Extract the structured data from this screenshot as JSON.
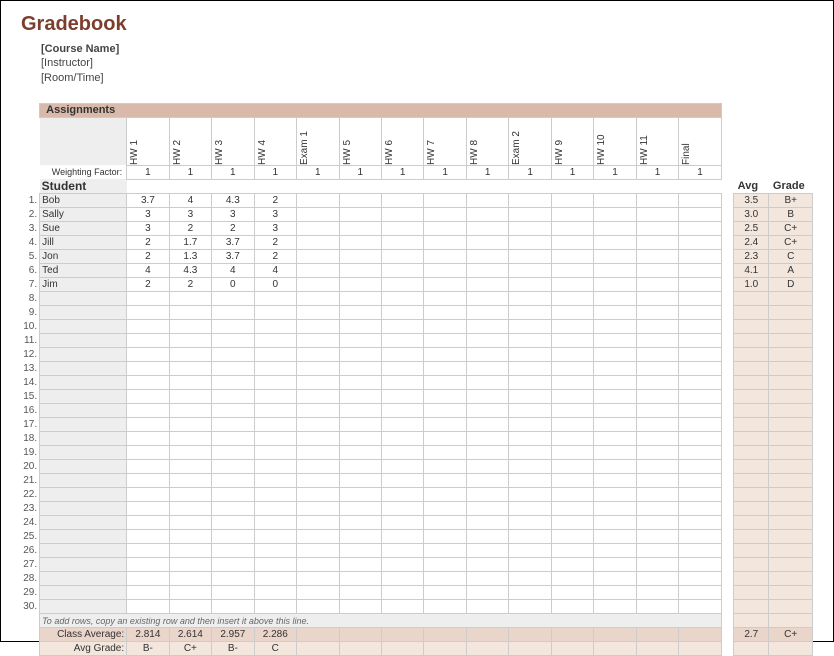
{
  "title": "Gradebook",
  "meta": {
    "course": "[Course Name]",
    "instructor": "[Instructor]",
    "roomtime": "[Room/Time]"
  },
  "assignments_label": "Assignments",
  "weighting_label": "Weighting Factor:",
  "student_label": "Student",
  "avg_label": "Avg",
  "grade_label": "Grade",
  "assignments": [
    "HW 1",
    "HW 2",
    "HW 3",
    "HW 4",
    "Exam 1",
    "HW 5",
    "HW 6",
    "HW 7",
    "HW 8",
    "Exam 2",
    "HW 9",
    "HW 10",
    "HW 11",
    "Final"
  ],
  "weights": [
    "1",
    "1",
    "1",
    "1",
    "1",
    "1",
    "1",
    "1",
    "1",
    "1",
    "1",
    "1",
    "1",
    "1"
  ],
  "students": [
    {
      "n": "1.",
      "name": "Bob",
      "scores": [
        "3.7",
        "4",
        "4.3",
        "2",
        "",
        "",
        "",
        "",
        "",
        "",
        "",
        "",
        "",
        ""
      ],
      "avg": "3.5",
      "grade": "B+"
    },
    {
      "n": "2.",
      "name": "Sally",
      "scores": [
        "3",
        "3",
        "3",
        "3",
        "",
        "",
        "",
        "",
        "",
        "",
        "",
        "",
        "",
        ""
      ],
      "avg": "3.0",
      "grade": "B"
    },
    {
      "n": "3.",
      "name": "Sue",
      "scores": [
        "3",
        "2",
        "2",
        "3",
        "",
        "",
        "",
        "",
        "",
        "",
        "",
        "",
        "",
        ""
      ],
      "avg": "2.5",
      "grade": "C+"
    },
    {
      "n": "4.",
      "name": "Jill",
      "scores": [
        "2",
        "1.7",
        "3.7",
        "2",
        "",
        "",
        "",
        "",
        "",
        "",
        "",
        "",
        "",
        ""
      ],
      "avg": "2.4",
      "grade": "C+"
    },
    {
      "n": "5.",
      "name": "Jon",
      "scores": [
        "2",
        "1.3",
        "3.7",
        "2",
        "",
        "",
        "",
        "",
        "",
        "",
        "",
        "",
        "",
        ""
      ],
      "avg": "2.3",
      "grade": "C"
    },
    {
      "n": "6.",
      "name": "Ted",
      "scores": [
        "4",
        "4.3",
        "4",
        "4",
        "",
        "",
        "",
        "",
        "",
        "",
        "",
        "",
        "",
        ""
      ],
      "avg": "4.1",
      "grade": "A"
    },
    {
      "n": "7.",
      "name": "Jim",
      "scores": [
        "2",
        "2",
        "0",
        "0",
        "",
        "",
        "",
        "",
        "",
        "",
        "",
        "",
        "",
        ""
      ],
      "avg": "1.0",
      "grade": "D"
    }
  ],
  "empty_rows": [
    "8.",
    "9.",
    "10.",
    "11.",
    "12.",
    "13.",
    "14.",
    "15.",
    "16.",
    "17.",
    "18.",
    "19.",
    "20.",
    "21.",
    "22.",
    "23.",
    "24.",
    "25.",
    "26.",
    "27.",
    "28.",
    "29.",
    "30."
  ],
  "note": "To add rows, copy an existing row and then insert it above this line.",
  "class_avg_label": "Class Average:",
  "class_avg": [
    "2.814",
    "2.614",
    "2.957",
    "2.286",
    "",
    "",
    "",
    "",
    "",
    "",
    "",
    "",
    "",
    ""
  ],
  "class_avg_total": "2.7",
  "class_avg_grade": "C+",
  "avg_grade_label": "Avg Grade:",
  "avg_grade": [
    "B-",
    "C+",
    "B-",
    "C",
    "",
    "",
    "",
    "",
    "",
    "",
    "",
    "",
    "",
    ""
  ]
}
